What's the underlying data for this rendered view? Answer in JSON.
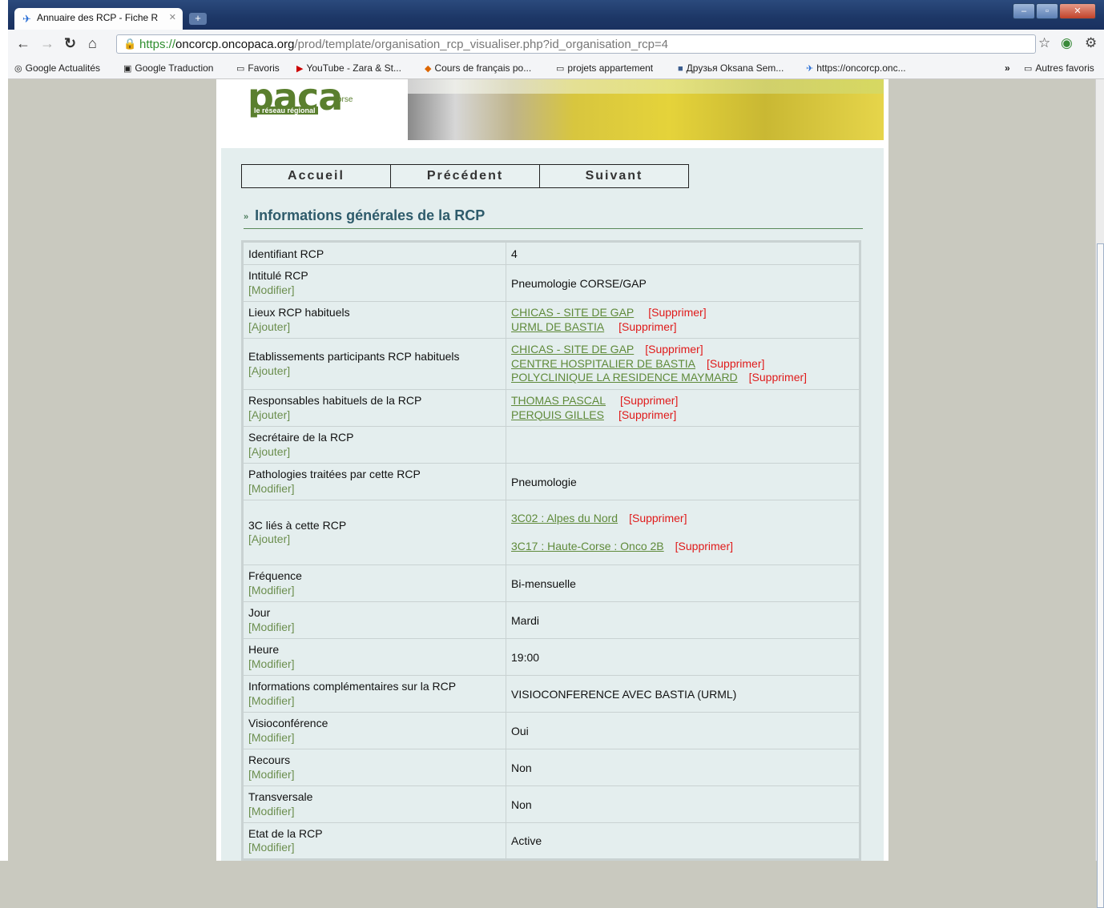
{
  "browser": {
    "tab_title": "Annuaire des RCP - Fiche R",
    "url_protocol": "https://",
    "url_host": "oncorcp.oncopaca.org",
    "url_path": "/prod/template/organisation_rcp_visualiser.php?id_organisation_rcp=4",
    "bookmarks": [
      "Google Actualités",
      "Google Traduction",
      "Favoris",
      "YouTube - Zara & St...",
      "Cours de français po...",
      "projets appartement",
      "Друзья Oksana Sem...",
      "https://oncorcp.onc...",
      "»",
      "Autres favoris"
    ]
  },
  "banner": {
    "logo_text": "paca",
    "logo_corse": "corse",
    "logo_sub": "le réseau régional"
  },
  "nav": {
    "home": "Accueil",
    "previous": "Précédent",
    "next": "Suivant"
  },
  "section": {
    "title": "Informations générales de la RCP"
  },
  "actions": {
    "modifier": "[Modifier]",
    "ajouter": "[Ajouter]",
    "supprimer": "[Supprimer]"
  },
  "rows": {
    "identifiant": {
      "label": "Identifiant RCP",
      "value": "4"
    },
    "intitule": {
      "label": "Intitulé RCP",
      "value": "Pneumologie CORSE/GAP"
    },
    "lieux": {
      "label": "Lieux RCP habituels",
      "items": [
        "CHICAS - SITE DE GAP",
        "URML DE BASTIA"
      ]
    },
    "etablissements": {
      "label": "Etablissements participants RCP habituels",
      "items": [
        "CHICAS - SITE DE GAP",
        "CENTRE HOSPITALIER DE BASTIA",
        "POLYCLINIQUE LA RESIDENCE MAYMARD"
      ]
    },
    "responsables": {
      "label": "Responsables habituels de la RCP",
      "items": [
        "THOMAS PASCAL",
        "PERQUIS GILLES"
      ]
    },
    "secretaire": {
      "label": "Secrétaire de la RCP",
      "value": ""
    },
    "pathologies": {
      "label": "Pathologies traitées par cette RCP",
      "value": "Pneumologie"
    },
    "trois_c": {
      "label": "3C liés à cette RCP",
      "items": [
        "3C02 : Alpes du Nord",
        "3C17 : Haute-Corse : Onco 2B"
      ]
    },
    "frequence": {
      "label": "Fréquence",
      "value": "Bi-mensuelle"
    },
    "jour": {
      "label": "Jour",
      "value": "Mardi"
    },
    "heure": {
      "label": "Heure",
      "value": "19:00"
    },
    "infos": {
      "label": "Informations complémentaires sur la RCP",
      "value": "VISIOCONFERENCE AVEC BASTIA (URML)"
    },
    "visio": {
      "label": "Visioconférence",
      "value": "Oui"
    },
    "recours": {
      "label": "Recours",
      "value": "Non"
    },
    "transversale": {
      "label": "Transversale",
      "value": "Non"
    },
    "etat": {
      "label": "Etat de la RCP",
      "value": "Active"
    }
  }
}
